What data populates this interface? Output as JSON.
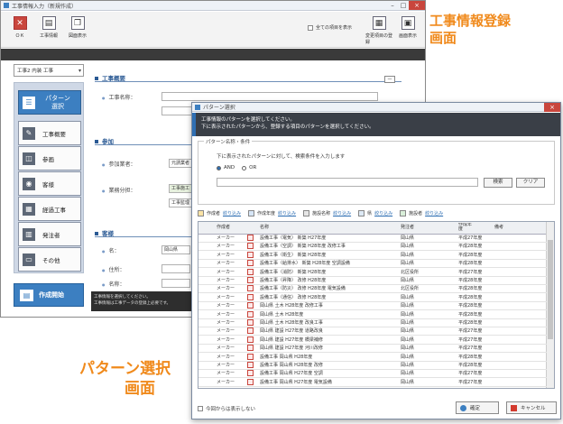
{
  "annotations": {
    "main_line1": "工事情報登録",
    "main_line2": "画面",
    "pattern_line1": "パターン選択",
    "pattern_line2": "画面"
  },
  "main_window": {
    "title": "工事情報入力（新規作成）",
    "toolbar": {
      "btn1": "ＯＫ",
      "btn2": "工事情報",
      "btn3": "図面表示",
      "checkbox_label": "全ての項目を表示",
      "btn4": "変更項目の登録",
      "btn5": "画面表示"
    },
    "select_value": "工事2 内装 工事",
    "sidebar": {
      "btn1": "パターン選択",
      "btn2": "工事概要",
      "btn3": "参画",
      "btn4": "客様",
      "btn5": "経過工事",
      "btn6": "発注者",
      "btn7": "その他",
      "bigbtn": "作成開始"
    },
    "form": {
      "sec1": "工事概要",
      "label1": "工事名称：",
      "sec2": "参加",
      "label2": "参加業者：",
      "value2": "元請業者",
      "label3": "業務分担：",
      "value3a": "工事施工",
      "value3b": "工事監理",
      "sec3": "客様",
      "label4": "名：",
      "value4": "岡山県",
      "label5": "住所：",
      "label6": "名称："
    },
    "status_line1": "工事情報を選択してください。",
    "status_line2": "工事情報は工事データの登録上必要です。"
  },
  "dialog": {
    "title": "パターン選択",
    "header_line1": "工事情報のパターンを選択してください。",
    "header_line2": "下に表示されたパターンから、登録する項目のパターンを選択してください。",
    "group_title": "パターン名称・条件",
    "group_hint": "下に表示されたパターンに対して、検索条件を入力します",
    "radio_and": "AND",
    "radio_or": "OR",
    "search_btn": "検索",
    "clear_btn": "クリア",
    "toolbar": {
      "t1": "作成者",
      "t1l": "絞り込み",
      "t2": "作成年度",
      "t2l": "絞り込み",
      "t3": "施設名称",
      "t3l": "絞り込み",
      "t4": "県",
      "t4l": "絞り込み",
      "t5": "施設者",
      "t5l": "絞り込み"
    },
    "columns": {
      "c1": "作成者",
      "c2": "名称",
      "c3": "発注者",
      "c4": "作成年度",
      "c5": "備考"
    },
    "rows": [
      {
        "author": "メーカー",
        "name": "設備工事（電気） 新築 H27年度",
        "orderer": "岡山県",
        "year": "平成27年度"
      },
      {
        "author": "メーカー",
        "name": "設備工事（空調） 新築 H28年度 改修工事",
        "orderer": "岡山県",
        "year": "平成28年度"
      },
      {
        "author": "メーカー",
        "name": "設備工事（衛生） 新築 H28年度",
        "orderer": "岡山県",
        "year": "平成28年度"
      },
      {
        "author": "メーカー",
        "name": "設備工事（給排水） 新築 H28年度 空調設備",
        "orderer": "岡山県",
        "year": "平成28年度"
      },
      {
        "author": "メーカー",
        "name": "設備工事（消防） 新築 H28年度",
        "orderer": "北区役所",
        "year": "平成27年度"
      },
      {
        "author": "メーカー",
        "name": "設備工事（昇降） 改修 H28年度",
        "orderer": "岡山県",
        "year": "平成28年度"
      },
      {
        "author": "メーカー",
        "name": "設備工事（防災） 改修 H28年度 電気設備",
        "orderer": "北区役所",
        "year": "平成28年度"
      },
      {
        "author": "メーカー",
        "name": "設備工事（通信） 改修 H28年度",
        "orderer": "岡山県",
        "year": "平成28年度"
      },
      {
        "author": "メーカー",
        "name": "岡山県 土木 H28年度 改修工事",
        "orderer": "岡山県",
        "year": "平成28年度"
      },
      {
        "author": "メーカー",
        "name": "岡山県 土木 H28年度",
        "orderer": "岡山県",
        "year": "平成28年度"
      },
      {
        "author": "メーカー",
        "name": "岡山県 土木 H28年度 改良工事",
        "orderer": "岡山県",
        "year": "平成28年度"
      },
      {
        "author": "メーカー",
        "name": "岡山県 建設 H27年度 道路改良",
        "orderer": "岡山県",
        "year": "平成27年度"
      },
      {
        "author": "メーカー",
        "name": "岡山県 建設 H27年度 橋梁補修",
        "orderer": "岡山県",
        "year": "平成27年度"
      },
      {
        "author": "メーカー",
        "name": "岡山県 建設 H27年度 河川改修",
        "orderer": "岡山県",
        "year": "平成27年度"
      },
      {
        "author": "メーカー",
        "name": "設備工事 岡山県 H28年度",
        "orderer": "岡山県",
        "year": "平成28年度"
      },
      {
        "author": "メーカー",
        "name": "設備工事 岡山県 H28年度 改修",
        "orderer": "岡山県",
        "year": "平成28年度"
      },
      {
        "author": "メーカー",
        "name": "設備工事 岡山県 H27年度 空調",
        "orderer": "岡山県",
        "year": "平成27年度"
      },
      {
        "author": "メーカー",
        "name": "設備工事 岡山県 H27年度 電気設備",
        "orderer": "岡山県",
        "year": "平成27年度"
      }
    ],
    "footer_checkbox": "今回からは表示しない",
    "ok_btn": "確定",
    "cancel_btn": "キャンセル"
  },
  "colors": {
    "accent": "#3c7fc1",
    "annotation": "#f08a1c",
    "header_dark": "#3a3f47"
  }
}
